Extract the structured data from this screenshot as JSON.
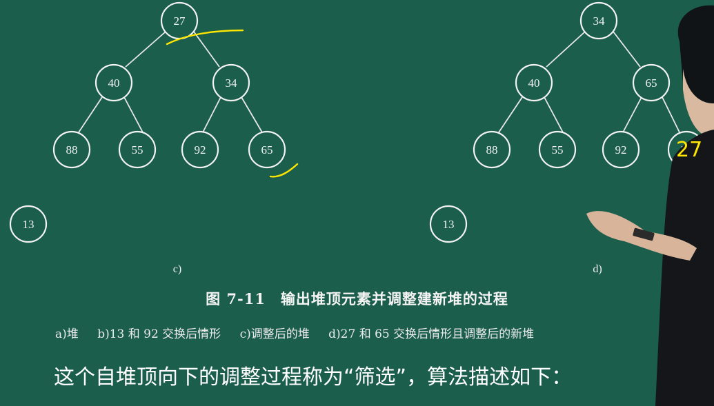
{
  "figure": {
    "caption": "图 7-11　输出堆顶元素并调整建新堆的过程",
    "legend": [
      "a)堆",
      "b)13 和 92 交换后情形",
      "c)调整后的堆",
      "d)27 和 65 交换后情形且调整后的新堆"
    ],
    "panel_c": {
      "label": "c)",
      "nodes": [
        "27",
        "40",
        "34",
        "88",
        "55",
        "92",
        "65"
      ],
      "removed": "13"
    },
    "panel_d": {
      "label": "d)",
      "nodes": [
        "34",
        "40",
        "65",
        "88",
        "55",
        "92",
        "27"
      ],
      "removed": "13"
    }
  },
  "subtitle": "这个自堆顶向下的调整过程称为“筛选”，算法描述如下：",
  "overlay_number": "27",
  "colors": {
    "board": "#1c5e4c",
    "chalk": "#f2f2f2",
    "highlight": "#ffe600"
  }
}
